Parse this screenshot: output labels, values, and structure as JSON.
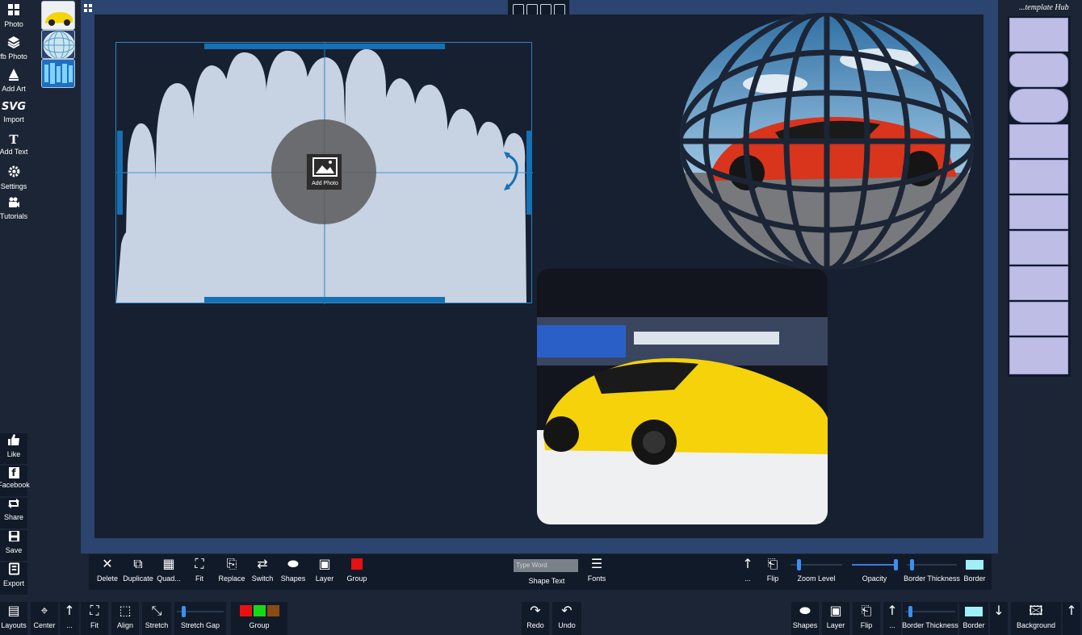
{
  "sidebar": {
    "top_items": [
      {
        "label": "Photo",
        "icon": "photo-grid-icon"
      },
      {
        "label": "fb Photo",
        "icon": "layers-icon"
      },
      {
        "label": "Add Art",
        "icon": "art-icon"
      },
      {
        "label": "Import",
        "icon": "svg-icon"
      },
      {
        "label": "Add Text",
        "icon": "text-icon"
      },
      {
        "label": "Settings",
        "icon": "gear-icon"
      },
      {
        "label": "Tutorials",
        "icon": "camera-icon"
      }
    ],
    "svg_glyph": "SVG",
    "text_glyph": "T",
    "bottom_items": [
      {
        "label": "Like",
        "icon": "thumbs-up-icon"
      },
      {
        "label": "Facebook",
        "icon": "facebook-icon"
      },
      {
        "label": "Share",
        "icon": "share-icon"
      },
      {
        "label": "Save",
        "icon": "save-icon"
      },
      {
        "label": "Export",
        "icon": "export-icon"
      }
    ],
    "facebook_glyph": "f"
  },
  "canvas": {
    "add_photo_label": "Add Photo"
  },
  "template_hub": {
    "title": "...template Hub"
  },
  "toolbar1": {
    "left_buttons": [
      "Delete",
      "Duplicate",
      "Quad...",
      "Fit",
      "Replace",
      "Switch",
      "Shapes",
      "Layer",
      "Group"
    ],
    "group_color": "#e81010",
    "text_placeholder": "Type Word",
    "shape_text_label": "Shape Text",
    "fonts_label": "Fonts",
    "more_label": "...",
    "flip_label": "Flip",
    "zoom_label": "Zoom Level",
    "opacity_label": "Opacity",
    "border_thickness_label": "Border Thickness",
    "border_label": "Border",
    "border_color": "#9ff0f8"
  },
  "toolbar2": {
    "layouts_label": "Layouts",
    "center_label": "Center",
    "more_label": "...",
    "fit_label": "Fit",
    "align_label": "Align",
    "stretch_label": "Stretch",
    "stretch_gap_label": "Stretch Gap",
    "group_label": "Group",
    "group_colors": [
      "#e81010",
      "#16d916",
      "#8a4a12"
    ],
    "redo_label": "Redo",
    "undo_label": "Undo",
    "shapes_label": "Shapes",
    "layer_label": "Layer",
    "flip_label": "Flip",
    "more2_label": "...",
    "border_thickness_label": "Border Thickness",
    "border_label": "Border",
    "border_color": "#9ff0f8",
    "background_label": "Background"
  }
}
